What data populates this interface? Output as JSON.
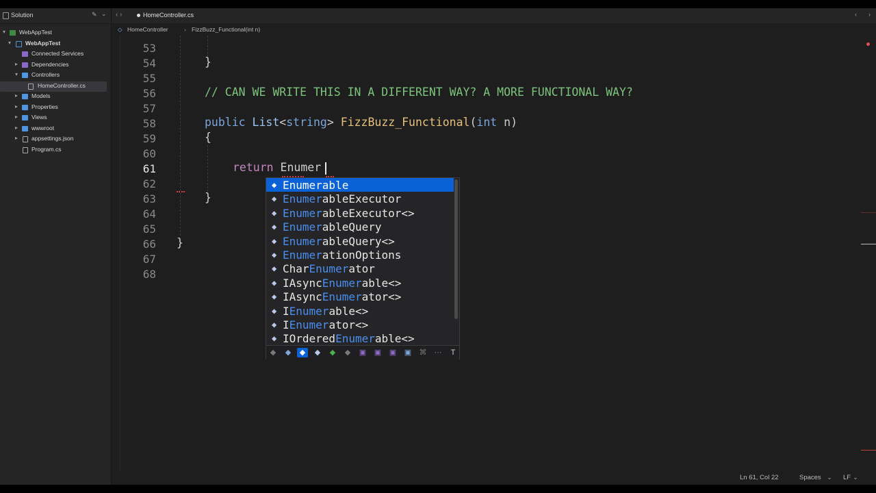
{
  "sidebar": {
    "title": "Solution",
    "items": [
      {
        "label": "WebAppTest",
        "icon": "solution-icon"
      },
      {
        "label": "WebAppTest",
        "icon": "project-icon"
      },
      {
        "label": "Connected Services",
        "icon": "folder-icon"
      },
      {
        "label": "Dependencies",
        "icon": "folder-icon"
      },
      {
        "label": "Controllers",
        "icon": "folder-icon"
      },
      {
        "label": "HomeController.cs",
        "icon": "file-icon"
      },
      {
        "label": "Models",
        "icon": "folder-icon"
      },
      {
        "label": "Properties",
        "icon": "folder-icon"
      },
      {
        "label": "Views",
        "icon": "folder-icon"
      },
      {
        "label": "wwwroot",
        "icon": "folder-icon"
      },
      {
        "label": "appsettings.json",
        "icon": "file-icon"
      },
      {
        "label": "Program.cs",
        "icon": "file-icon"
      }
    ]
  },
  "tab": {
    "label": "HomeController.cs"
  },
  "breadcrumb": {
    "class_name": "HomeController",
    "method_name": "FizzBuzz_Functional(int n)"
  },
  "editor": {
    "line_numbers": [
      "53",
      "54",
      "55",
      "56",
      "57",
      "58",
      "59",
      "60",
      "61",
      "62",
      "63",
      "64",
      "65",
      "66",
      "67",
      "68"
    ],
    "code": {
      "l54": "}",
      "l56": "// CAN WE WRITE THIS IN A DIFFERENT WAY? A MORE FUNCTIONAL WAY?",
      "l58_public": "public",
      "l58_list": "List",
      "l58_lt": "<",
      "l58_string": "string",
      "l58_gt": "> ",
      "l58_fn": "FizzBuzz_Functional",
      "l58_open": "(",
      "l58_int": "int",
      "l58_param": " n)",
      "l59": "{",
      "l61_return": "return",
      "l61_typed": "Enumer",
      "l63": "}",
      "l66": "}"
    }
  },
  "completion": {
    "items": [
      {
        "match": "Enumer",
        "rest": "able",
        "pre": ""
      },
      {
        "match": "Enumer",
        "rest": "ableExecutor",
        "pre": ""
      },
      {
        "match": "Enumer",
        "rest": "ableExecutor<>",
        "pre": ""
      },
      {
        "match": "Enumer",
        "rest": "ableQuery",
        "pre": ""
      },
      {
        "match": "Enumer",
        "rest": "ableQuery<>",
        "pre": ""
      },
      {
        "match": "Enumer",
        "rest": "ationOptions",
        "pre": ""
      },
      {
        "pre": "Char",
        "match": "Enumer",
        "rest": "ator"
      },
      {
        "pre": "IAsync",
        "match": "Enumer",
        "rest": "able<>"
      },
      {
        "pre": "IAsync",
        "match": "Enumer",
        "rest": "ator<>"
      },
      {
        "pre": "I",
        "match": "Enumer",
        "rest": "able<>"
      },
      {
        "pre": "I",
        "match": "Enumer",
        "rest": "ator<>"
      },
      {
        "pre": "IOrdered",
        "match": "Enumer",
        "rest": "able<>"
      }
    ],
    "filter_icons": [
      "◆",
      "◆",
      "◆",
      "◆",
      "◆",
      "◆",
      "▣",
      "▣",
      "▣",
      "▣",
      "⌘",
      "⋯",
      "T"
    ]
  },
  "status": {
    "position": "Ln 61, Col 22",
    "indent": "Spaces",
    "line_ending": "LF"
  },
  "colors": {
    "accent": "#0a62d6",
    "comment": "#7cc47c",
    "keyword": "#c586c0",
    "function": "#e5c07b"
  }
}
